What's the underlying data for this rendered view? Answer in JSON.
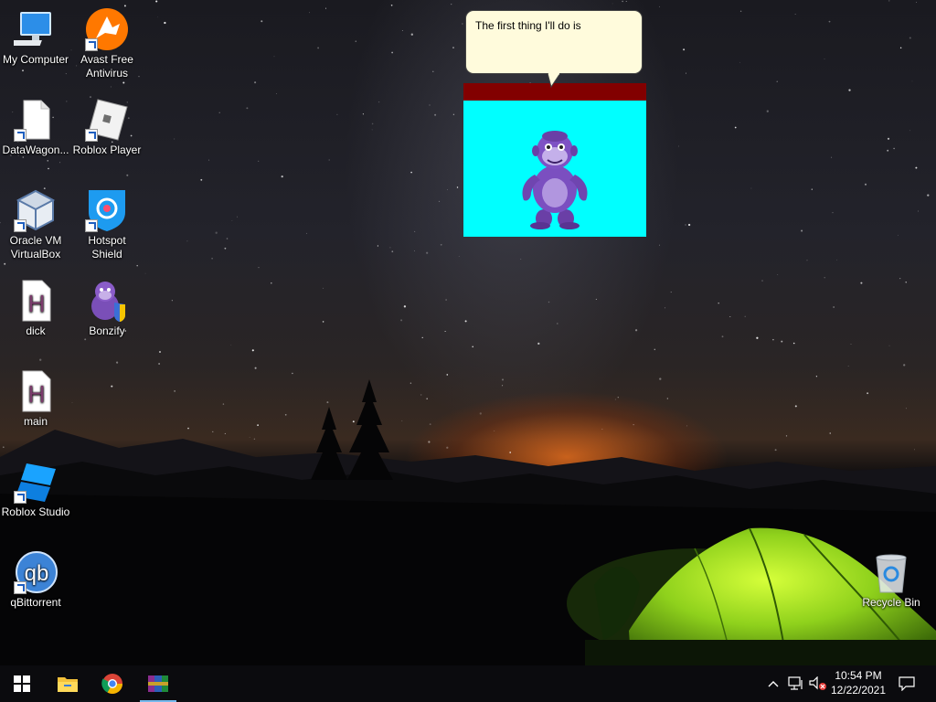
{
  "desktop": {
    "icons": [
      {
        "label": "My Computer"
      },
      {
        "label": "Avast Free Antivirus"
      },
      {
        "label": "DataWagon..."
      },
      {
        "label": "Roblox Player"
      },
      {
        "label": "Oracle VM VirtualBox"
      },
      {
        "label": "Hotspot Shield"
      },
      {
        "label": "dick"
      },
      {
        "label": "Bonzify"
      },
      {
        "label": "main"
      },
      {
        "label": "Roblox Studio"
      },
      {
        "label": "qBittorrent"
      },
      {
        "label": "Recycle Bin"
      }
    ]
  },
  "bonzi": {
    "speech": "The first thing I'll do is"
  },
  "taskbar": {
    "pinned": [
      "start-icon",
      "file-explorer-icon",
      "chrome-icon",
      "winrar-icon"
    ],
    "time": "10:54 PM",
    "date": "12/22/2021"
  },
  "colors": {
    "stage": "#00ffff",
    "bar": "#820000",
    "bubble": "#fffbdc",
    "taskbar": "#0b0b0e",
    "accent": "#76b9ed"
  }
}
